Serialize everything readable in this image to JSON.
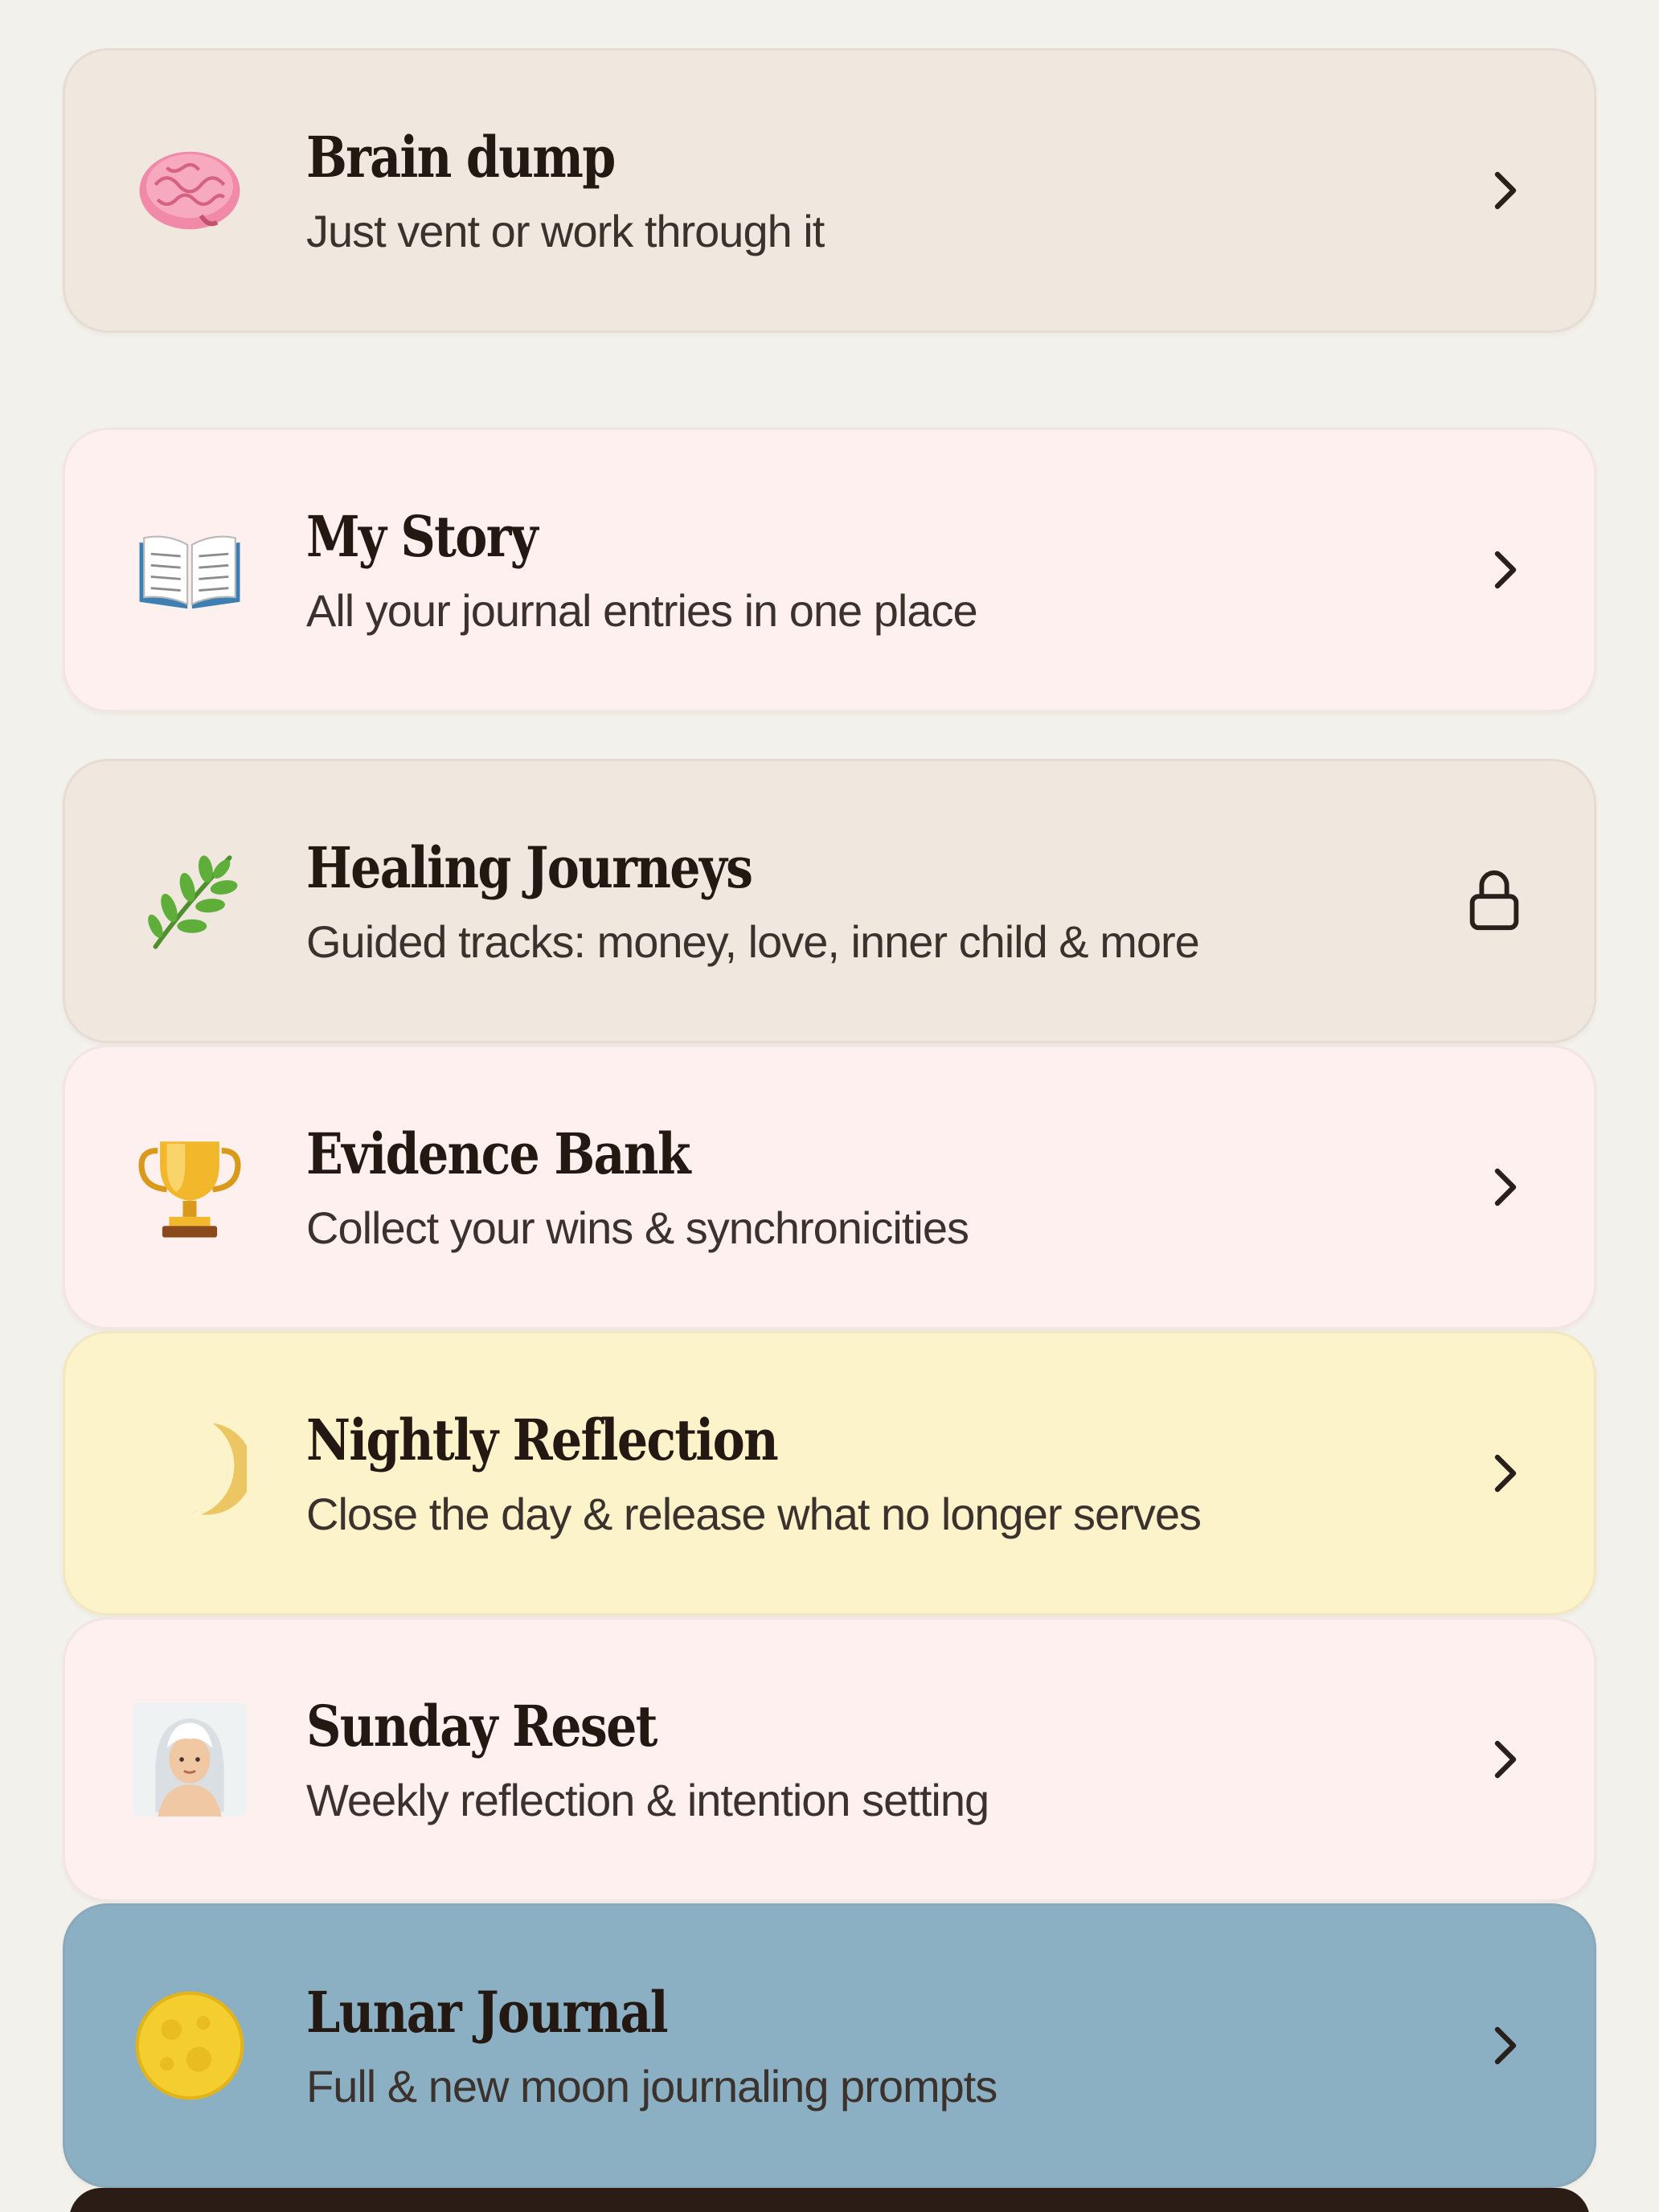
{
  "cards": [
    {
      "title": "Brain dump",
      "subtitle": "Just vent or work through it",
      "icon": "brain-icon",
      "trailing": "chevron-right-icon",
      "color": "#f0e7df"
    },
    {
      "title": "My Story",
      "subtitle": "All your journal entries in one place",
      "icon": "open-book-icon",
      "trailing": "chevron-right-icon",
      "color": "#fdf0ee"
    },
    {
      "title": "Healing Journeys",
      "subtitle": "Guided tracks: money, love, inner child & more",
      "icon": "herb-icon",
      "trailing": "lock-icon",
      "color": "#f0e7df"
    },
    {
      "title": "Evidence Bank",
      "subtitle": "Collect your wins & synchronicities",
      "icon": "trophy-icon",
      "trailing": "chevron-right-icon",
      "color": "#fdf0ee"
    },
    {
      "title": "Nightly Reflection",
      "subtitle": "Close the day & release what no longer serves",
      "icon": "crescent-moon-icon",
      "trailing": "chevron-right-icon",
      "color": "#fcf3cb"
    },
    {
      "title": "Sunday Reset",
      "subtitle": "Weekly reflection & intention setting",
      "icon": "person-in-steamy-room-icon",
      "trailing": "chevron-right-icon",
      "color": "#fdf0ee"
    },
    {
      "title": "Lunar Journal",
      "subtitle": "Full & new moon journaling prompts",
      "icon": "full-moon-icon",
      "trailing": "chevron-right-icon",
      "color": "#8bafc3"
    }
  ]
}
